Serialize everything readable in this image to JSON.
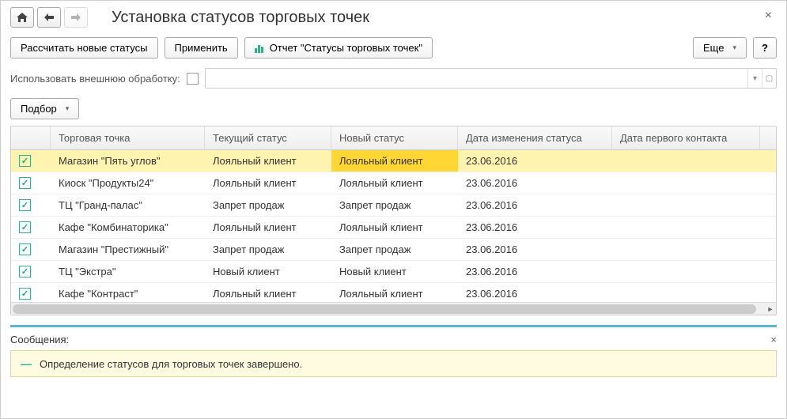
{
  "title": "Установка статусов торговых точек",
  "toolbar": {
    "calc": "Рассчитать новые статусы",
    "apply": "Применить",
    "report": "Отчет \"Статусы торговых точек\"",
    "more": "Еще",
    "help": "?"
  },
  "option": {
    "label": "Использовать внешнюю обработку:"
  },
  "select_btn": "Подбор",
  "columns": {
    "point": "Торговая точка",
    "current": "Текущий статус",
    "new": "Новый статус",
    "change_date": "Дата изменения статуса",
    "first_contact": "Дата первого контакта"
  },
  "rows": [
    {
      "checked": true,
      "point": "Магазин \"Пять углов\"",
      "current": "Лояльный клиент",
      "new": "Лояльный клиент",
      "date": "23.06.2016",
      "first": "",
      "selected": true
    },
    {
      "checked": true,
      "point": "Киоск \"Продукты24\"",
      "current": "Лояльный клиент",
      "new": "Лояльный клиент",
      "date": "23.06.2016",
      "first": ""
    },
    {
      "checked": true,
      "point": "ТЦ \"Гранд-палас\"",
      "current": "Запрет продаж",
      "new": "Запрет продаж",
      "date": "23.06.2016",
      "first": ""
    },
    {
      "checked": true,
      "point": "Кафе \"Комбинаторика\"",
      "current": "Лояльный клиент",
      "new": "Лояльный клиент",
      "date": "23.06.2016",
      "first": ""
    },
    {
      "checked": true,
      "point": "Магазин \"Престижный\"",
      "current": "Запрет продаж",
      "new": "Запрет продаж",
      "date": "23.06.2016",
      "first": ""
    },
    {
      "checked": true,
      "point": "ТЦ \"Экстра\"",
      "current": "Новый клиент",
      "new": "Новый клиент",
      "date": "23.06.2016",
      "first": ""
    },
    {
      "checked": true,
      "point": "Кафе \"Контраст\"",
      "current": "Лояльный клиент",
      "new": "Лояльный клиент",
      "date": "23.06.2016",
      "first": ""
    }
  ],
  "messages": {
    "title": "Сообщения:",
    "text": "Определение статусов для торговых точек завершено."
  }
}
